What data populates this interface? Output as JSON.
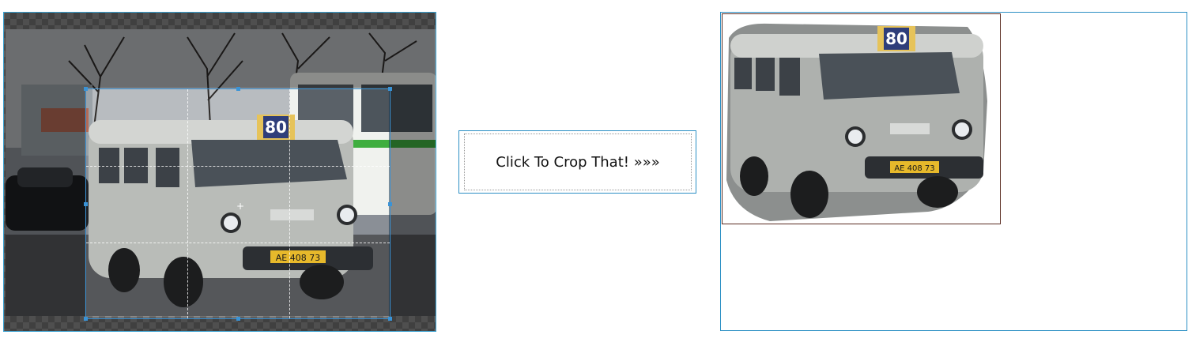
{
  "cropper": {
    "image_alt": "Minibus with route number 80",
    "route_number": "80",
    "plate": "AE 408 73"
  },
  "action": {
    "crop_button_label": "Click To Crop That! »»»"
  },
  "result": {
    "image_alt": "Cropped minibus with background removed",
    "route_number": "80",
    "plate": "AE 408 73"
  },
  "icons": [
    "move-cursor-icon"
  ],
  "colors": {
    "accent_border": "#2b8fc4",
    "crop_selection": "#3a93d6",
    "result_image_border": "#5a2b20"
  }
}
